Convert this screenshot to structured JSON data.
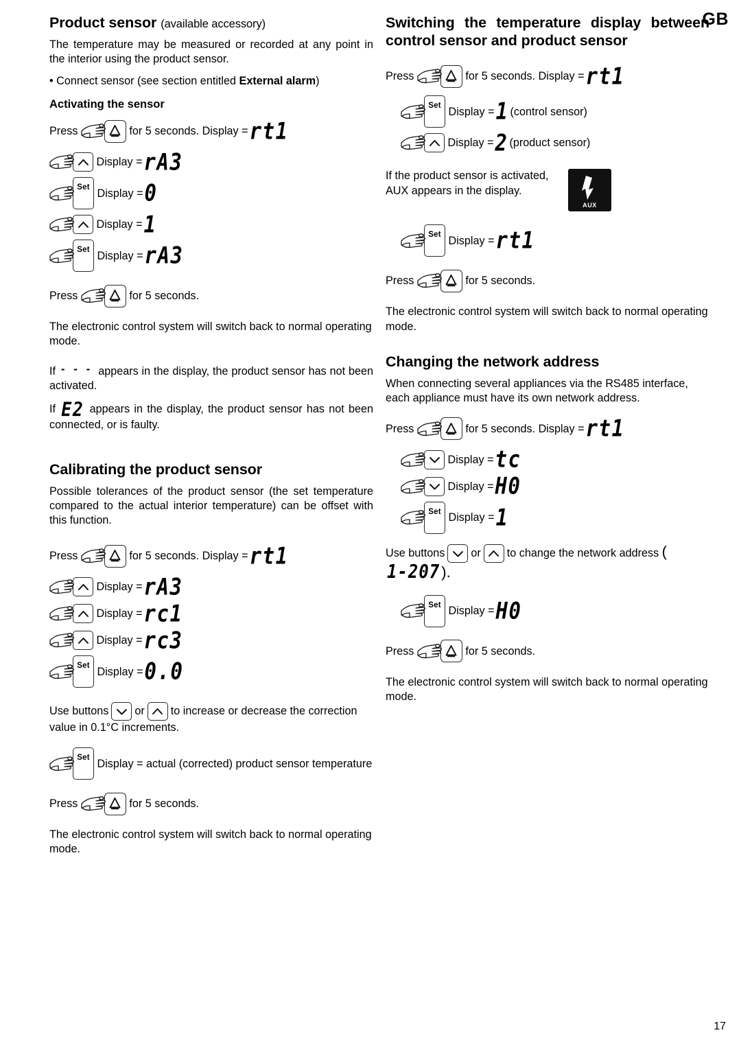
{
  "page": {
    "locale_marker": "GB",
    "number": "17"
  },
  "icons": {
    "hand": "pointing-hand-icon",
    "alarm_button": "alarm-bell-button-icon",
    "up_button": "up-arrow-button-icon",
    "down_button": "down-arrow-button-icon",
    "set_button_label": "Set",
    "aux_label": "AUX",
    "aux_arrow": "down-arrow-icon"
  },
  "left_column": {
    "product_sensor": {
      "heading": "Product sensor",
      "heading_suffix": "(available accessory)",
      "intro": "The temperature may be measured or recorded at any point in the interior using the product sensor.",
      "bullet": "• Connect sensor (see section entitled ",
      "bullet_bold": "External alarm",
      "bullet_end": ")",
      "subheading": "Activating the sensor",
      "steps": [
        {
          "pre": "Press",
          "button": "alarm",
          "post": "for 5 seconds. Display =",
          "display": "rt1"
        },
        {
          "pre": "",
          "button": "up",
          "post": "Display =",
          "display": "rA3"
        },
        {
          "pre": "",
          "button": "set",
          "post": "Display =",
          "display": "0"
        },
        {
          "pre": "",
          "button": "up",
          "post": "Display =",
          "display": "1"
        },
        {
          "pre": "",
          "button": "set",
          "post": "Display =",
          "display": "rA3"
        },
        {
          "pre": "Press",
          "button": "alarm",
          "post": "for 5 seconds.",
          "display": ""
        }
      ],
      "normal_mode": "The electronic control system will switch back to normal operating mode.",
      "note_dashes_pre": "If",
      "note_dashes_symbol": "- - -",
      "note_dashes_post": "appears in the display, the product sensor has not been activated.",
      "note_e2_pre": "If",
      "note_e2_symbol": "E2",
      "note_e2_post": "appears in the display, the product sensor has not been connected, or is faulty."
    },
    "calibrating": {
      "heading": "Calibrating the product sensor",
      "intro": "Possible tolerances of the product sensor (the set temperature compared to the actual interior temperature) can be offset with this function.",
      "steps": [
        {
          "pre": "Press",
          "button": "alarm",
          "post": "for 5 seconds. Display =",
          "display": "rt1"
        },
        {
          "pre": "",
          "button": "up",
          "post": "Display =",
          "display": "rA3"
        },
        {
          "pre": "",
          "button": "up",
          "post": "Display =",
          "display": "rc1"
        },
        {
          "pre": "",
          "button": "up",
          "post": "Display =",
          "display": "rc3"
        },
        {
          "pre": "",
          "button": "set",
          "post": "Display =",
          "display": "0.0"
        }
      ],
      "use_buttons_pre": "Use buttons",
      "use_buttons_or": "or",
      "use_buttons_post": "to increase or decrease the correction value in 0.1°C increments.",
      "final_set_step": {
        "button": "set",
        "post": "Display = actual (corrected) product sensor temperature"
      },
      "final_press": {
        "pre": "Press",
        "button": "alarm",
        "post": "for 5 seconds."
      },
      "normal_mode": "The electronic control system will switch back to normal operating mode."
    }
  },
  "right_column": {
    "switching": {
      "heading": "Switching the temperature display between control sensor and product sensor",
      "steps": [
        {
          "pre": "Press",
          "button": "alarm",
          "post": "for 5 seconds. Display =",
          "display": "rt1",
          "note": ""
        },
        {
          "pre": "",
          "button": "set",
          "post": "Display =",
          "display": "1",
          "note": "(control sensor)"
        },
        {
          "pre": "",
          "button": "up",
          "post": "Display =",
          "display": "2",
          "note": "(product sensor)"
        }
      ],
      "aux_text": "If the product sensor is activated, AUX appears in the display.",
      "steps_after": [
        {
          "pre": "",
          "button": "set",
          "post": "Display =",
          "display": "rt1"
        },
        {
          "pre": "Press",
          "button": "alarm",
          "post": "for 5 seconds.",
          "display": ""
        }
      ],
      "normal_mode": "The electronic control system will switch back to normal operating mode."
    },
    "network": {
      "heading": "Changing the network address",
      "intro": "When connecting several appliances via the RS485 interface, each appliance must have its own network address.",
      "steps": [
        {
          "pre": "Press",
          "button": "alarm",
          "post": "for 5 seconds. Display =",
          "display": "rt1"
        },
        {
          "pre": "",
          "button": "down",
          "post": "Display =",
          "display": "tc"
        },
        {
          "pre": "",
          "button": "down",
          "post": "Display =",
          "display": "H0"
        },
        {
          "pre": "",
          "button": "set",
          "post": "Display =",
          "display": "1"
        }
      ],
      "use_buttons_pre": "Use buttons",
      "use_buttons_or": "or",
      "use_buttons_post": "to change the network address",
      "address_range": "1-207",
      "address_suffix": ").",
      "steps_after": [
        {
          "pre": "",
          "button": "set",
          "post": "Display =",
          "display": "H0"
        },
        {
          "pre": "Press",
          "button": "alarm",
          "post": "for 5 seconds.",
          "display": ""
        }
      ],
      "normal_mode": "The electronic control system will switch back to normal operating mode."
    }
  }
}
